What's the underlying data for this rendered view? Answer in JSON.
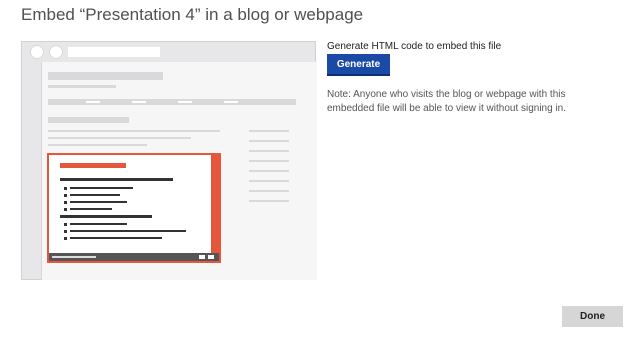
{
  "dialog": {
    "title": "Embed “Presentation 4” in a blog or webpage"
  },
  "generate": {
    "label": "Generate HTML code to embed this file",
    "button_label": "Generate"
  },
  "note": "Note: Anyone who visits the blog or webpage with this embedded file will be able to view it without signing in.",
  "footer": {
    "done_label": "Done"
  },
  "colors": {
    "accent": "#1a4aa6",
    "slide_accent": "#e4573d"
  }
}
